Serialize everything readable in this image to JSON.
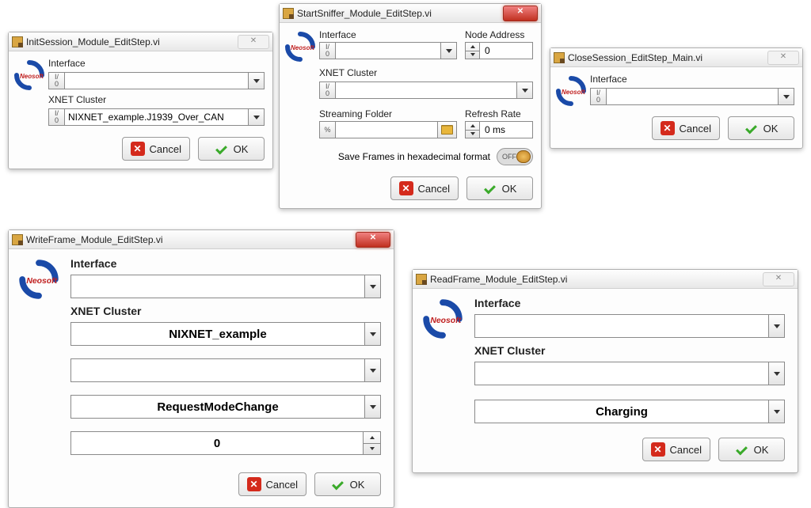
{
  "common": {
    "cancel": "Cancel",
    "ok": "OK",
    "close_x": "✕"
  },
  "initSession": {
    "title": "InitSession_Module_EditStep.vi",
    "interface_label": "Interface",
    "interface_value": "",
    "cluster_label": "XNET Cluster",
    "cluster_value": "NIXNET_example.J1939_Over_CAN"
  },
  "startSniffer": {
    "title": "StartSniffer_Module_EditStep.vi",
    "interface_label": "Interface",
    "interface_value": "",
    "node_label": "Node Address",
    "node_value": "0",
    "cluster_label": "XNET Cluster",
    "cluster_value": "",
    "folder_label": "Streaming Folder",
    "folder_value": "",
    "refresh_label": "Refresh Rate",
    "refresh_value": "0 ms",
    "hex_label": "Save Frames in hexadecimal format",
    "hex_state": "OFF"
  },
  "closeSession": {
    "title": "CloseSession_EditStep_Main.vi",
    "interface_label": "Interface",
    "interface_value": ""
  },
  "writeFrame": {
    "title": "WriteFrame_Module_EditStep.vi",
    "interface_label": "Interface",
    "interface_value": "",
    "cluster_label": "XNET Cluster",
    "cluster_value": "NIXNET_example",
    "field3_value": "",
    "field4_value": "RequestModeChange",
    "field5_value": "0"
  },
  "readFrame": {
    "title": "ReadFrame_Module_EditStep.vi",
    "interface_label": "Interface",
    "interface_value": "",
    "cluster_label": "XNET Cluster",
    "cluster_value": "",
    "field3_value": "Charging"
  }
}
